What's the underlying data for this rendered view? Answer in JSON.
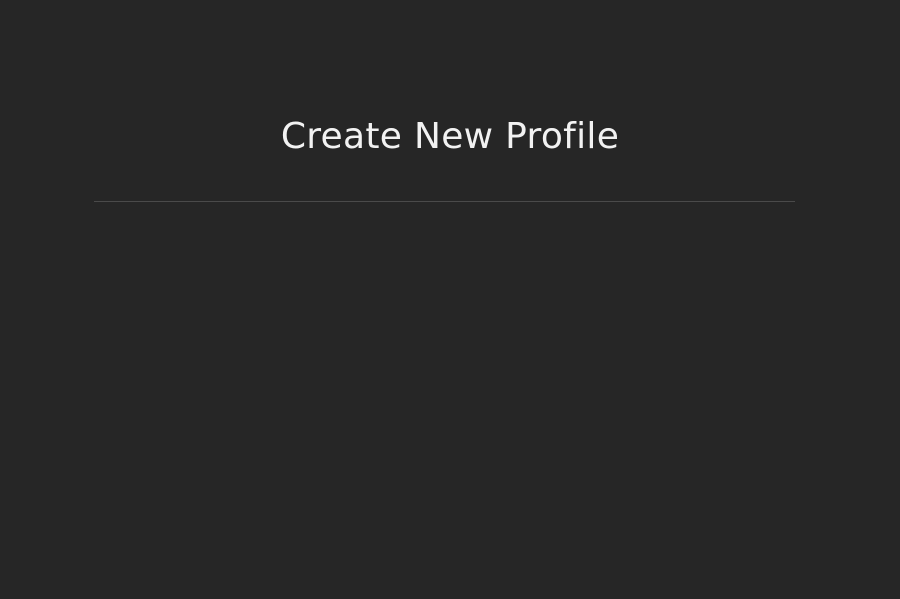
{
  "page": {
    "title": "Create New Profile"
  },
  "colors": {
    "background": "#262626",
    "title_text": "#f2f2f2",
    "divider": "#4a4a4a"
  }
}
